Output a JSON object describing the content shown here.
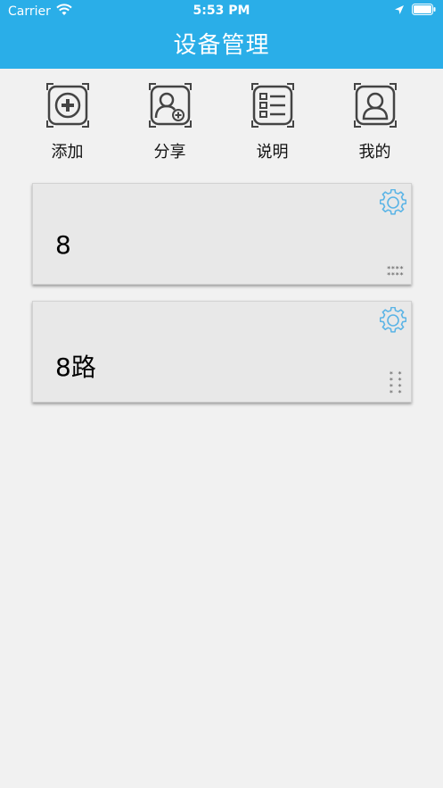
{
  "status": {
    "carrier": "Carrier",
    "time": "5:53 PM",
    "wifi_icon": "wifi-icon",
    "location_icon": "location-arrow-icon",
    "battery_icon": "battery-icon"
  },
  "header": {
    "title": "设备管理",
    "background": "#2aaee8"
  },
  "toolbar": {
    "items": [
      {
        "label": "添加",
        "icon": "add-circle-icon"
      },
      {
        "label": "分享",
        "icon": "share-user-icon"
      },
      {
        "label": "说明",
        "icon": "list-icon"
      },
      {
        "label": "我的",
        "icon": "profile-icon"
      }
    ]
  },
  "devices": [
    {
      "name": "8",
      "settings_icon": "gear-icon",
      "pattern": "****\n****"
    },
    {
      "name": "8路",
      "settings_icon": "gear-icon",
      "pattern": "* *\n* *\n* *\n* *"
    }
  ],
  "colors": {
    "accent": "#2aaee8",
    "gear": "#5ab4e6",
    "card": "#e8e8e8",
    "page": "#f1f1f1"
  }
}
